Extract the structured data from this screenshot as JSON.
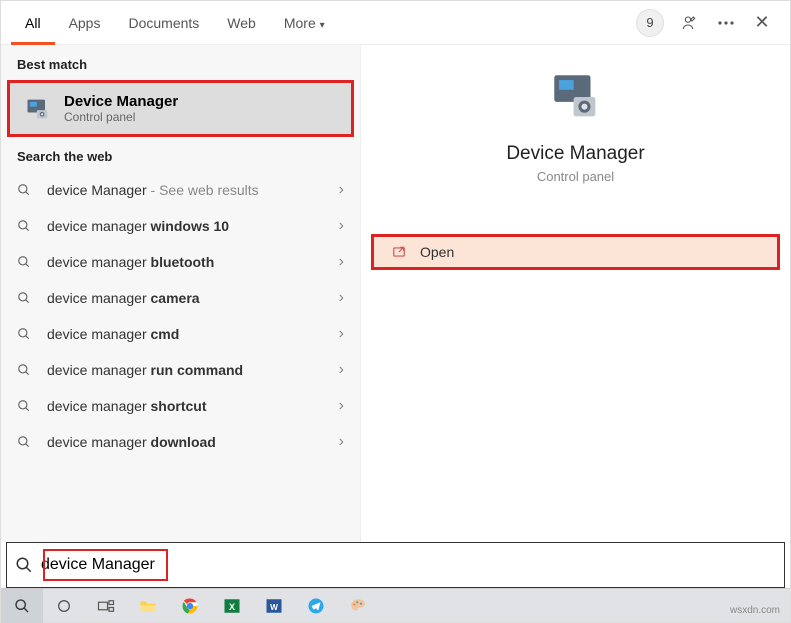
{
  "tabs": {
    "t0": "All",
    "t1": "Apps",
    "t2": "Documents",
    "t3": "Web",
    "t4": "More"
  },
  "header": {
    "badge": "9"
  },
  "sections": {
    "best": "Best match",
    "web": "Search the web"
  },
  "bestmatch": {
    "title": "Device Manager",
    "subtitle": "Control panel"
  },
  "web_base": "device Manager",
  "web_base2": "device manager",
  "web_suffix": "- See web results",
  "web": {
    "r0": "",
    "r1": "windows 10",
    "r2": "bluetooth",
    "r3": "camera",
    "r4": "cmd",
    "r5": "run command",
    "r6": "shortcut",
    "r7": "download"
  },
  "preview": {
    "title": "Device Manager",
    "subtitle": "Control panel",
    "open": "Open"
  },
  "search": {
    "value": "device Manager"
  },
  "watermark": "wsxdn.com"
}
